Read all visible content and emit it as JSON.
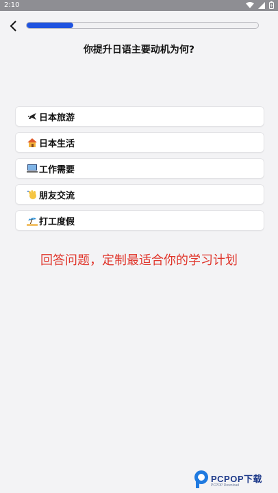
{
  "status": {
    "time": "2:10"
  },
  "page": {
    "title": "你提升日语主要动机为何?"
  },
  "progress": {
    "value_percent": 20
  },
  "options": [
    {
      "label": "日本旅游",
      "icon": "airplane-icon"
    },
    {
      "label": "日本生活",
      "icon": "house-icon"
    },
    {
      "label": "工作需要",
      "icon": "computer-icon"
    },
    {
      "label": "朋友交流",
      "icon": "waving-hand-icon"
    },
    {
      "label": "打工度假",
      "icon": "beach-umbrella-icon"
    }
  ],
  "caption": "回答问题，定制最适合你的学习计划",
  "watermark": {
    "brand": "PCPOP下载",
    "sub": "PCPOP Download"
  },
  "colors": {
    "accent": "#1f53e0",
    "caption": "#e0352b",
    "background": "#f3f3f5",
    "statusbar": "#8e8e93"
  }
}
